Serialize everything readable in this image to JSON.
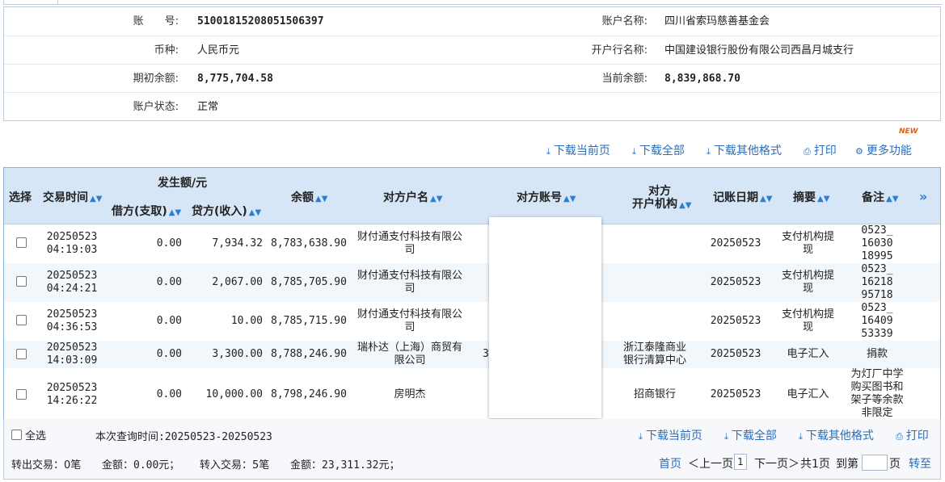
{
  "account": {
    "account_no_label": "账　　号:",
    "account_no": "51001815208051506397",
    "account_name_label": "账户名称:",
    "account_name": "四川省索玛慈善基金会",
    "currency_label": "币种:",
    "currency": "人民币元",
    "bank_label": "开户行名称:",
    "bank": "中国建设银行股份有限公司西昌月城支行",
    "opening_balance_label": "期初余额:",
    "opening_balance": "8,775,704.58",
    "current_balance_label": "当前余额:",
    "current_balance": "8,839,868.70",
    "status_label": "账户状态:",
    "status": "正常"
  },
  "toolbar": {
    "download_page": "下载当前页",
    "download_all": "下载全部",
    "download_other": "下载其他格式",
    "print": "打印",
    "more": "更多功能",
    "new_badge": "NEW"
  },
  "table": {
    "headers": {
      "select": "选择",
      "time": "交易时间",
      "amount_group": "发生额/元",
      "debit": "借方(支取)",
      "credit": "贷方(收入)",
      "balance": "余额",
      "cp_name": "对方户名",
      "cp_account": "对方账号",
      "cp_bank_line1": "对方",
      "cp_bank_line2": "开户机构",
      "book_date": "记账日期",
      "summary": "摘要",
      "remark": "备注",
      "more": "»"
    },
    "rows": [
      {
        "date": "20250523",
        "time": "04:19:03",
        "debit": "0.00",
        "credit": "7,934.32",
        "balance": "8,783,638.90",
        "cp_name_1": "财付通支付科技有限公",
        "cp_name_2": "司",
        "acct_peek": "",
        "cp_bank_1": "",
        "cp_bank_2": "",
        "book_date": "20250523",
        "summary_1": "支付机构提",
        "summary_2": "现",
        "remark_1": "0523_",
        "remark_2": "16030",
        "remark_3": "18995",
        "remark_4": ""
      },
      {
        "date": "20250523",
        "time": "04:24:21",
        "debit": "0.00",
        "credit": "2,067.00",
        "balance": "8,785,705.90",
        "cp_name_1": "财付通支付科技有限公",
        "cp_name_2": "司",
        "acct_peek": "",
        "cp_bank_1": "",
        "cp_bank_2": "",
        "book_date": "20250523",
        "summary_1": "支付机构提",
        "summary_2": "现",
        "remark_1": "0523_",
        "remark_2": "16218",
        "remark_3": "95718",
        "remark_4": ""
      },
      {
        "date": "20250523",
        "time": "04:36:53",
        "debit": "0.00",
        "credit": "10.00",
        "balance": "8,785,715.90",
        "cp_name_1": "财付通支付科技有限公",
        "cp_name_2": "司",
        "acct_peek": "",
        "cp_bank_1": "",
        "cp_bank_2": "",
        "book_date": "20250523",
        "summary_1": "支付机构提",
        "summary_2": "现",
        "remark_1": "0523_",
        "remark_2": "16409",
        "remark_3": "53339",
        "remark_4": ""
      },
      {
        "date": "20250523",
        "time": "14:03:09",
        "debit": "0.00",
        "credit": "3,300.00",
        "balance": "8,788,246.90",
        "cp_name_1": "瑞朴达（上海）商贸有",
        "cp_name_2": "限公司",
        "acct_peek": "3",
        "cp_bank_1": "浙江泰隆商业",
        "cp_bank_2": "银行清算中心",
        "book_date": "20250523",
        "summary_1": "电子汇入",
        "summary_2": "",
        "remark_1": "捐款",
        "remark_2": "",
        "remark_3": "",
        "remark_4": ""
      },
      {
        "date": "20250523",
        "time": "14:26:22",
        "debit": "0.00",
        "credit": "10,000.00",
        "balance": "8,798,246.90",
        "cp_name_1": "房明杰",
        "cp_name_2": "",
        "acct_peek": "",
        "cp_bank_1": "招商银行",
        "cp_bank_2": "",
        "book_date": "20250523",
        "summary_1": "电子汇入",
        "summary_2": "",
        "remark_1": "为灯厂中学",
        "remark_2": "购买图书和",
        "remark_3": "架子等余款",
        "remark_4": "非限定"
      }
    ]
  },
  "footer": {
    "select_all": "全选",
    "query_time": "本次查询时间:20250523-20250523",
    "download_page": "下载当前页",
    "download_all": "下载全部",
    "download_other": "下载其他格式",
    "print": "打印",
    "out_count": "转出交易：0笔",
    "out_amount": "金额：0.00元；",
    "in_count": "转入交易：5笔",
    "in_amount": "金额：23,311.32元；",
    "first_page": "首页",
    "prev_page": "＜上一页",
    "current_page": "1",
    "next_page": "下一页＞",
    "total_pages": "共1页",
    "goto_prefix": "到第",
    "goto_suffix": "页",
    "goto_button": "转至"
  },
  "colors": {
    "header_bg": "#d6e6f6",
    "link": "#2a6ebb",
    "sort_icon": "#2a7fd0",
    "badge": "#e85d00"
  }
}
